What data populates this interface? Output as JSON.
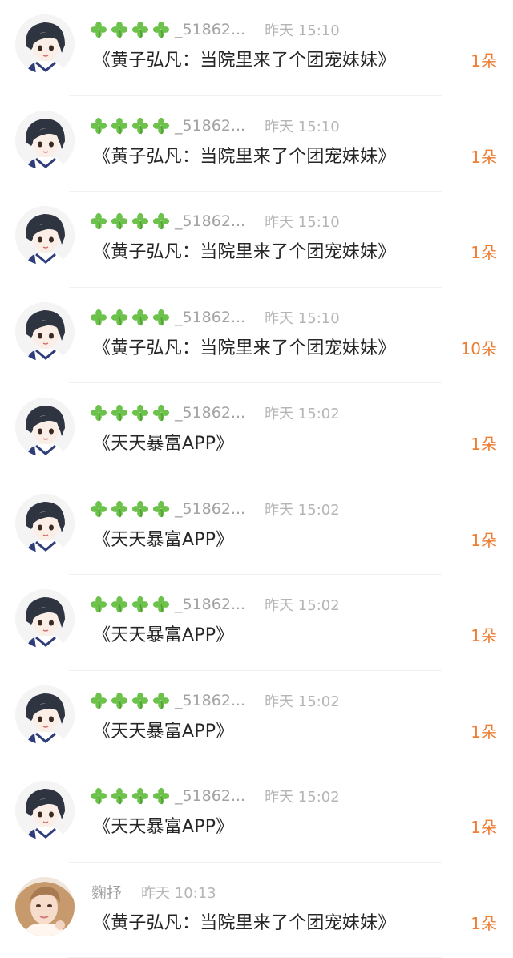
{
  "colors": {
    "accent": "#ef7d32",
    "clover": "#6cc24a",
    "username": "#a3a3a3",
    "time": "#b5b5b5",
    "title": "#262626"
  },
  "items": [
    {
      "avatar": "anime-boy",
      "clovers": 4,
      "user": "🍀🍀🍀🍀_51862...",
      "time": "昨天 15:10",
      "title": "《黄子弘凡：当院里来了个团宠妹妹》",
      "count": "1朵"
    },
    {
      "avatar": "anime-boy",
      "clovers": 4,
      "user": "🍀🍀🍀🍀_51862...",
      "time": "昨天 15:10",
      "title": "《黄子弘凡：当院里来了个团宠妹妹》",
      "count": "1朵"
    },
    {
      "avatar": "anime-boy",
      "clovers": 4,
      "user": "🍀🍀🍀🍀_51862...",
      "time": "昨天 15:10",
      "title": "《黄子弘凡：当院里来了个团宠妹妹》",
      "count": "1朵"
    },
    {
      "avatar": "anime-boy",
      "clovers": 4,
      "user": "🍀🍀🍀🍀_51862...",
      "time": "昨天 15:10",
      "title": "《黄子弘凡：当院里来了个团宠妹妹》",
      "count": "10朵"
    },
    {
      "avatar": "anime-boy",
      "clovers": 4,
      "user": "🍀🍀🍀🍀_51862...",
      "time": "昨天 15:02",
      "title": "《天天暴富APP》",
      "count": "1朵"
    },
    {
      "avatar": "anime-boy",
      "clovers": 4,
      "user": "🍀🍀🍀🍀_51862...",
      "time": "昨天 15:02",
      "title": "《天天暴富APP》",
      "count": "1朵"
    },
    {
      "avatar": "anime-boy",
      "clovers": 4,
      "user": "🍀🍀🍀🍀_51862...",
      "time": "昨天 15:02",
      "title": "《天天暴富APP》",
      "count": "1朵"
    },
    {
      "avatar": "anime-boy",
      "clovers": 4,
      "user": "🍀🍀🍀🍀_51862...",
      "time": "昨天 15:02",
      "title": "《天天暴富APP》",
      "count": "1朵"
    },
    {
      "avatar": "anime-boy",
      "clovers": 4,
      "user": "🍀🍀🍀🍀_51862...",
      "time": "昨天 15:02",
      "title": "《天天暴富APP》",
      "count": "1朵"
    },
    {
      "avatar": "woman-photo",
      "clovers": 0,
      "user": "麴抒",
      "time": "昨天 10:13",
      "title": "《黄子弘凡：当院里来了个团宠妹妹》",
      "count": "1朵"
    }
  ]
}
